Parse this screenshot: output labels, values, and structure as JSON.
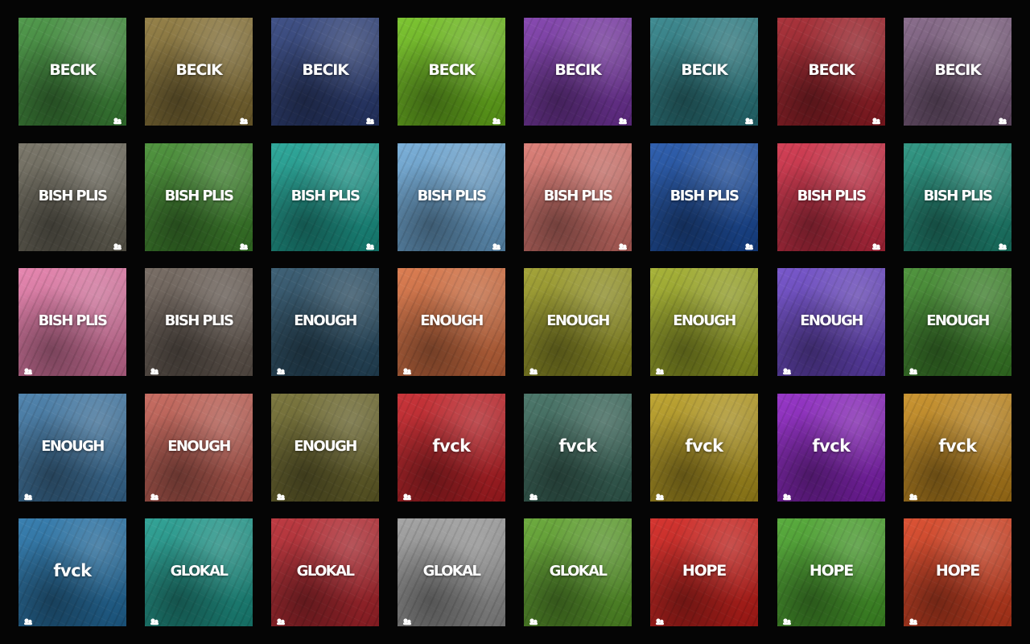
{
  "tiles": [
    {
      "label": "BECIK",
      "color": "#3f8f3a"
    },
    {
      "label": "BECIK",
      "color": "#8a7436"
    },
    {
      "label": "BECIK",
      "color": "#2c3f7a"
    },
    {
      "label": "BECIK",
      "color": "#6fbf1c"
    },
    {
      "label": "BECIK",
      "color": "#7a36a8"
    },
    {
      "label": "BECIK",
      "color": "#2b7f86"
    },
    {
      "label": "BECIK",
      "color": "#a11e27"
    },
    {
      "label": "BECIK",
      "color": "#7d5e80"
    },
    {
      "label": "BISH PLIS",
      "color": "#6e6a5c"
    },
    {
      "label": "BISH PLIS",
      "color": "#3f8a2c"
    },
    {
      "label": "BISH PLIS",
      "color": "#1aa091"
    },
    {
      "label": "BISH PLIS",
      "color": "#6da8d6"
    },
    {
      "label": "BISH PLIS",
      "color": "#d9746c"
    },
    {
      "label": "BISH PLIS",
      "color": "#1a4fa6"
    },
    {
      "label": "BISH PLIS",
      "color": "#cf2c44"
    },
    {
      "label": "BISH PLIS",
      "color": "#1e8d78"
    },
    {
      "label": "BISH PLIS",
      "color": "#e47aa8"
    },
    {
      "label": "BISH PLIS",
      "color": "#6b5f56"
    },
    {
      "label": "ENOUGH",
      "color": "#2a5068"
    },
    {
      "label": "ENOUGH",
      "color": "#d87040"
    },
    {
      "label": "ENOUGH",
      "color": "#9a9a24"
    },
    {
      "label": "ENOUGH",
      "color": "#9eab24"
    },
    {
      "label": "ENOUGH",
      "color": "#6a46c6"
    },
    {
      "label": "ENOUGH",
      "color": "#3e8a2a"
    },
    {
      "label": "ENOUGH",
      "color": "#3f78a6"
    },
    {
      "label": "ENOUGH",
      "color": "#c25e52"
    },
    {
      "label": "ENOUGH",
      "color": "#6f6a2c"
    },
    {
      "label": "fvck",
      "color": "#c41f25"
    },
    {
      "label": "fvck",
      "color": "#3a6a5c"
    },
    {
      "label": "fvck",
      "color": "#b89c1e"
    },
    {
      "label": "fvck",
      "color": "#8c22c2"
    },
    {
      "label": "fvck",
      "color": "#c58a1c"
    },
    {
      "label": "fvck",
      "color": "#2472a8"
    },
    {
      "label": "GLOKAL",
      "color": "#1d9a8c"
    },
    {
      "label": "GLOKAL",
      "color": "#b7262e"
    },
    {
      "label": "GLOKAL",
      "color": "#9c9c9c"
    },
    {
      "label": "GLOKAL",
      "color": "#5da22a"
    },
    {
      "label": "HOPE",
      "color": "#d11f1a"
    },
    {
      "label": "HOPE",
      "color": "#48a42a"
    },
    {
      "label": "HOPE",
      "color": "#d8401f"
    }
  ]
}
